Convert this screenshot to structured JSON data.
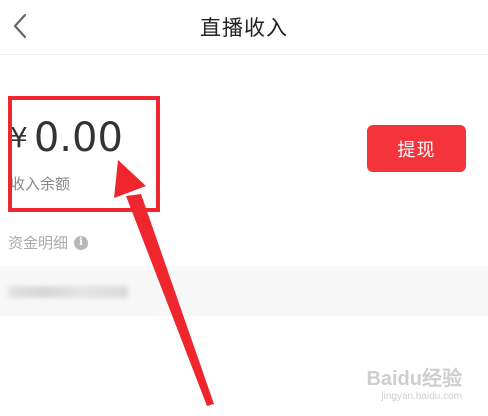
{
  "header": {
    "title": "直播收入",
    "back_icon": "chevron-left-icon"
  },
  "balance": {
    "currency": "¥",
    "amount": "0.00",
    "label": "收入余额"
  },
  "actions": {
    "withdraw_label": "提现"
  },
  "fund_details": {
    "label": "资金明细",
    "info_icon_glyph": "i"
  },
  "annotation": {
    "color": "#f0262f"
  },
  "colors": {
    "accent": "#f5333b",
    "highlight": "#f0262f"
  },
  "watermark": {
    "brand": "Baidu经验",
    "url": "jingyan.baidu.com"
  }
}
